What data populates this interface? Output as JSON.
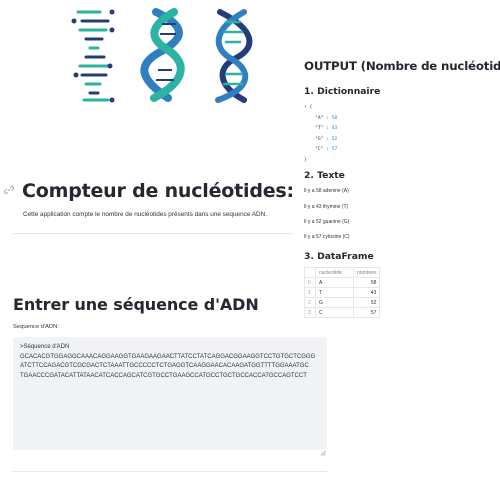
{
  "main": {
    "title": "Compteur de nucléotides",
    "description": "Cette application compte le nombre de nucléotides présents dans une sequence ADN.",
    "section_heading": "Entrer une séquence d'ADN",
    "input": {
      "label": "Sequence d'ADN:",
      "value": ">Séquence d'ADN\nGCACACGTGGAGGCAAACAGGAAGGTGAAGAAGAACTTATCCTATCAGGACGGAAGGTCCTGTGCTCGGG\nATCTTCCAGACGTCGCGACTCTAAATTGCCCCCTCTGAGGTCAAGGAACACAAGATGGTTTTGGAAATGC\nTGAACCCGATACATTATAACATCACCAGCATCGTGCCTGAAGCCATGCCTGCTGCCACCATGCCAGTCCT"
    }
  },
  "output": {
    "title": "OUTPUT (Nombre de nucléotides)",
    "dict_heading": "1. Dictionnaire",
    "dict": [
      {
        "key": "\"A\"",
        "value": "58"
      },
      {
        "key": "\"T\"",
        "value": "43"
      },
      {
        "key": "\"G\"",
        "value": "52"
      },
      {
        "key": "\"C\"",
        "value": "57"
      }
    ],
    "text_heading": "2. Texte",
    "text_lines": [
      "Il y a 58 adenine (A)",
      "Il y a 43 thymine (T)",
      "Il y a 52 guanine (G)",
      "Il y a 57 cytosine (C)"
    ],
    "df_heading": "3. DataFrame",
    "df_columns": [
      "nucleotide",
      "nombres"
    ],
    "df_rows": [
      {
        "index": "0",
        "nucleotide": "A",
        "count": "58"
      },
      {
        "index": "1",
        "nucleotide": "T",
        "count": "43"
      },
      {
        "index": "2",
        "nucleotide": "G",
        "count": "52"
      },
      {
        "index": "3",
        "nucleotide": "C",
        "count": "57"
      }
    ]
  },
  "icons": {
    "logo": "dna-logo-icon",
    "anchor": "link-icon",
    "resize": "resize-handle-icon",
    "collapse": "collapse-caret-icon"
  },
  "colors": {
    "teal": "#2bb3a3",
    "navy": "#243c78",
    "blue": "#2f7fc1",
    "json_value": "#1c83e1"
  }
}
